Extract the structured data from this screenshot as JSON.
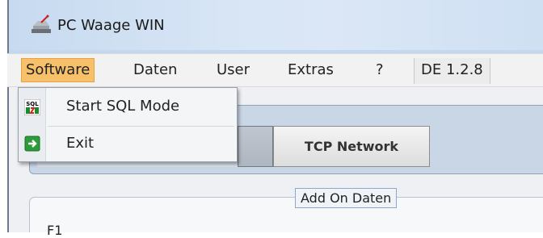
{
  "window": {
    "title": "PC Waage WIN",
    "app_icon": "scale-icon"
  },
  "menubar": {
    "items": [
      {
        "label": "Software",
        "active": true
      },
      {
        "label": "Daten"
      },
      {
        "label": "User"
      },
      {
        "label": "Extras"
      },
      {
        "label": "?"
      }
    ],
    "version": "DE 1.2.8"
  },
  "software_menu": {
    "items": [
      {
        "label": "Start SQL Mode",
        "icon": "sql-icon"
      },
      {
        "label": "Exit",
        "icon": "exit-icon"
      }
    ]
  },
  "tabs": [
    {
      "label": ""
    },
    {
      "label": "TCP Network"
    }
  ],
  "addon_group": {
    "title": "Add On Daten",
    "field_label": "F1"
  },
  "colors": {
    "menu_active": "#f7c06b",
    "titlebar": "#c7daf0"
  }
}
